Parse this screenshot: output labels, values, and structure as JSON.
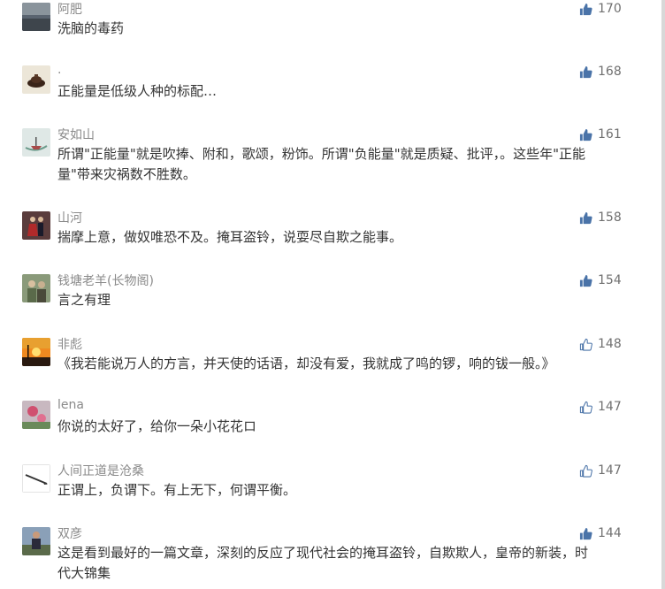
{
  "comments": [
    {
      "username": "阿肥",
      "text": "洗脑的毒药",
      "likes": "170",
      "liked": true,
      "avatar_icon": "misty-landscape-avatar"
    },
    {
      "username": ".",
      "text": "正能量是低级人种的标配…",
      "likes": "168",
      "liked": true,
      "avatar_icon": "teapot-avatar"
    },
    {
      "username": "安如山",
      "text": "所谓\"正能量\"就是吹捧、附和，歌颂，粉饰。所谓\"负能量\"就是质疑、批评，。这些年\"正能量\"带来灾祸数不胜数。",
      "likes": "161",
      "liked": true,
      "avatar_icon": "boat-painting-avatar"
    },
    {
      "username": "山河",
      "text": "揣摩上意，做奴唯恐不及。掩耳盗铃，说耍尽自欺之能事。",
      "likes": "158",
      "liked": true,
      "avatar_icon": "dancers-avatar"
    },
    {
      "username": "钱塘老羊(长物阁)",
      "text": "言之有理",
      "likes": "154",
      "liked": true,
      "avatar_icon": "two-people-avatar"
    },
    {
      "username": "非彪",
      "text": "《我若能说万人的方言，并天使的话语，却没有爱，我就成了鸣的锣，响的钹一般。》",
      "likes": "148",
      "liked": false,
      "avatar_icon": "sunset-avatar"
    },
    {
      "username": "lena",
      "text": "你说的太好了，给你一朵小花花ロ",
      "likes": "147",
      "liked": false,
      "avatar_icon": "flower-avatar"
    },
    {
      "username": "人间正道是沧桑",
      "text": "正谓上，负谓下。有上无下，何谓平衡。",
      "likes": "147",
      "liked": false,
      "avatar_icon": "pen-avatar"
    },
    {
      "username": "双彦",
      "text": "这是看到最好的一篇文章，深刻的反应了现代社会的掩耳盗铃，自欺欺人，皇帝的新装，时代大锦集",
      "likes": "144",
      "liked": true,
      "avatar_icon": "person-avatar"
    }
  ],
  "colors": {
    "like_filled": "#4a73a8",
    "like_outline": "#4a73a8",
    "username": "#8a8a8a",
    "text": "#333333"
  }
}
